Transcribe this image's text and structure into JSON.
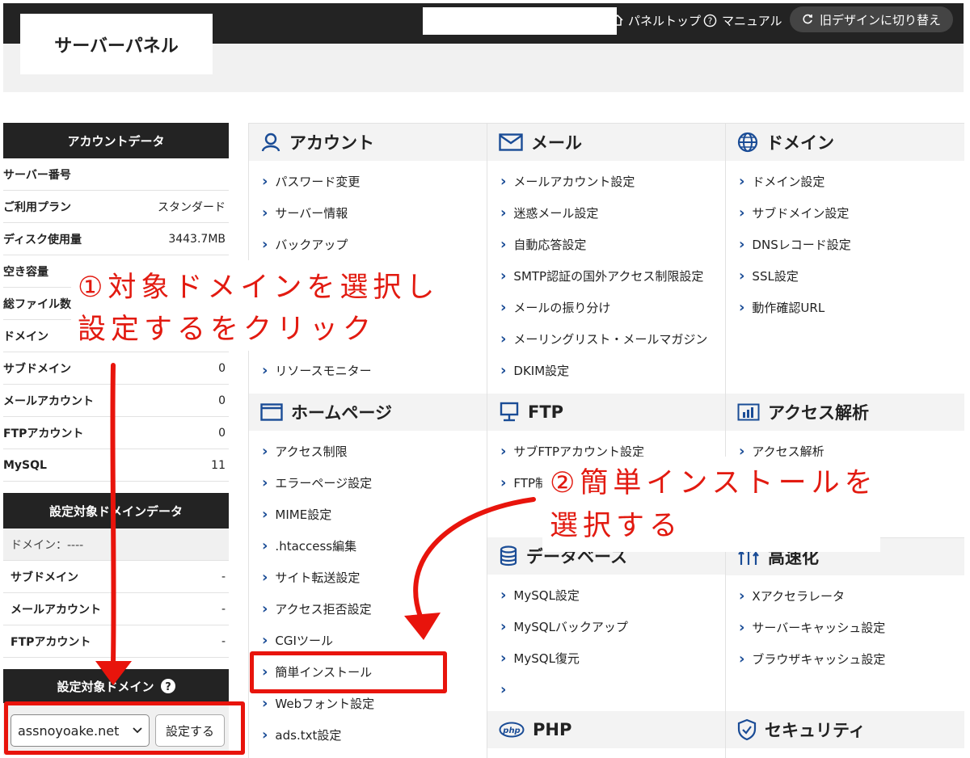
{
  "header": {
    "panel_top": "パネルトップ",
    "manual": "マニュアル",
    "old_design": "旧デザインに切り替え",
    "logo": "サーバーパネル"
  },
  "sidebar": {
    "account_title": "アカウントデータ",
    "account_rows": [
      {
        "label": "サーバー番号",
        "value": ""
      },
      {
        "label": "ご利用プラン",
        "value": "スタンダード"
      },
      {
        "label": "ディスク使用量",
        "value": "3443.7MB"
      },
      {
        "label": "空き容量",
        "value": ""
      },
      {
        "label": "総ファイル数",
        "value": ""
      },
      {
        "label": "ドメイン",
        "value": ""
      },
      {
        "label": "サブドメイン",
        "value": "0"
      },
      {
        "label": "メールアカウント",
        "value": "0"
      },
      {
        "label": "FTPアカウント",
        "value": "0"
      },
      {
        "label": "MySQL",
        "value": "11"
      }
    ],
    "domain_title": "設定対象ドメインデータ",
    "domain_rows": [
      {
        "label": "ドメイン：----",
        "value": ""
      },
      {
        "label": "サブドメイン",
        "value": "-"
      },
      {
        "label": "メールアカウント",
        "value": "-"
      },
      {
        "label": "FTPアカウント",
        "value": "-"
      }
    ],
    "target_title": "設定対象ドメイン",
    "target_select": "assnoyoake.net",
    "set_button": "設定する"
  },
  "grid": {
    "account": {
      "title": "アカウント",
      "links": [
        "パスワード変更",
        "サーバー情報",
        "バックアップ",
        "",
        "",
        "",
        "リソースモニター"
      ]
    },
    "mail": {
      "title": "メール",
      "links": [
        "メールアカウント設定",
        "迷惑メール設定",
        "自動応答設定",
        "SMTP認証の国外アクセス制限設定",
        "メールの振り分け",
        "メーリングリスト・メールマガジン",
        "DKIM設定"
      ]
    },
    "domain": {
      "title": "ドメイン",
      "links": [
        "ドメイン設定",
        "サブドメイン設定",
        "DNSレコード設定",
        "SSL設定",
        "動作確認URL"
      ]
    },
    "homepage": {
      "title": "ホームページ",
      "links": [
        "アクセス制限",
        "エラーページ設定",
        "MIME設定",
        ".htaccess編集",
        "サイト転送設定",
        "アクセス拒否設定",
        "CGIツール",
        "簡単インストール",
        "Webフォント設定",
        "ads.txt設定"
      ]
    },
    "ftp": {
      "title": "FTP",
      "links": [
        "サブFTPアカウント設定",
        "FTP制"
      ]
    },
    "access": {
      "title": "アクセス解析",
      "links": [
        "アクセス解析"
      ]
    },
    "database": {
      "title": "データベース",
      "links": [
        "MySQL設定",
        "MySQLバックアップ",
        "MySQL復元",
        ""
      ]
    },
    "speed": {
      "title": "高速化",
      "links": [
        "Xアクセラレータ",
        "サーバーキャッシュ設定",
        "ブラウザキャッシュ設定"
      ]
    },
    "php": {
      "title": "PHP"
    },
    "security": {
      "title": "セキュリティ"
    }
  },
  "annotations": {
    "step1_line1": "①対象ドメインを選択し",
    "step1_line2": "設定するをクリック",
    "step2_line1": "②簡単インストールを",
    "step2_line2": "選択する"
  },
  "colors": {
    "accent_red": "#e21a10",
    "header_dark": "#232323",
    "icon_blue": "#1a4c96"
  }
}
